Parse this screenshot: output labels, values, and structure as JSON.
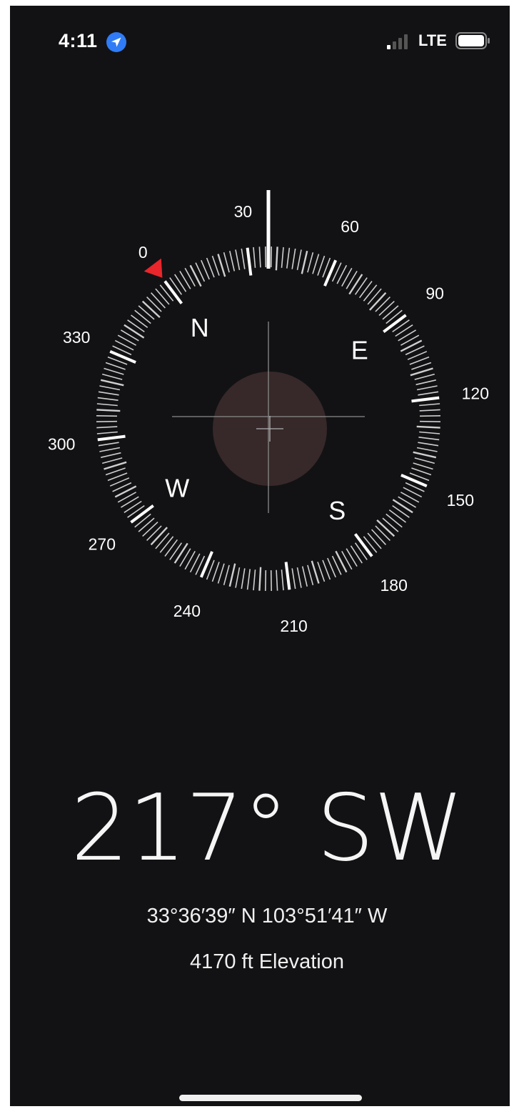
{
  "status_bar": {
    "time": "4:11",
    "network": "LTE",
    "location_icon": "location-arrow-icon",
    "signal_icon": "cellular-signal-icon",
    "battery_icon": "battery-icon"
  },
  "compass": {
    "heading_degrees": 217,
    "degree_labels": [
      "210",
      "240",
      "270",
      "300",
      "330",
      "0",
      "30",
      "60",
      "90",
      "120",
      "150",
      "180"
    ],
    "cardinals": {
      "north": "N",
      "east": "E",
      "south": "S",
      "west": "W"
    },
    "north_marker_color": "#e8262c"
  },
  "readout": {
    "heading": "217° SW",
    "coordinates": "33°36′39″ N  103°51′41″ W",
    "elevation": "4170 ft Elevation"
  }
}
